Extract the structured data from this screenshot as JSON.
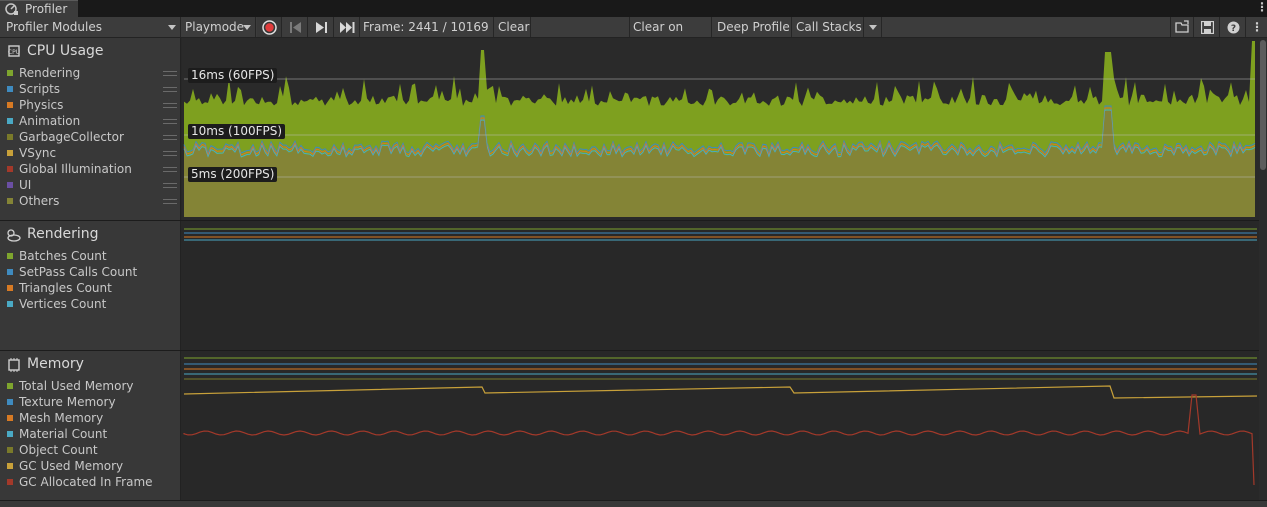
{
  "window": {
    "tab_title": "Profiler",
    "menu_glyph": "⋮"
  },
  "toolbar": {
    "modules_label": "Profiler Modules",
    "target_label": "Playmode",
    "record_icon": "record-icon",
    "frame_label": "Frame: 2441 / 10169",
    "clear_label": "Clear",
    "clear_on_play_label": "Clear on Play",
    "deep_profile_label": "Deep Profile",
    "call_stacks_label": "Call Stacks",
    "more_glyph": "⋮"
  },
  "cpu": {
    "title": "CPU Usage",
    "items": [
      {
        "label": "Rendering",
        "color": "#7ea52e"
      },
      {
        "label": "Scripts",
        "color": "#3f8bbf"
      },
      {
        "label": "Physics",
        "color": "#d77a24"
      },
      {
        "label": "Animation",
        "color": "#4aa9c4"
      },
      {
        "label": "GarbageCollector",
        "color": "#7a7a2a"
      },
      {
        "label": "VSync",
        "color": "#c8a13a"
      },
      {
        "label": "Global Illumination",
        "color": "#a3392a"
      },
      {
        "label": "UI",
        "color": "#6b4fa3"
      },
      {
        "label": "Others",
        "color": "#848436"
      }
    ],
    "markers": [
      "16ms (60FPS)",
      "10ms (100FPS)",
      "5ms (200FPS)"
    ]
  },
  "rendering": {
    "title": "Rendering",
    "items": [
      {
        "label": "Batches Count",
        "color": "#7ea52e"
      },
      {
        "label": "SetPass Calls Count",
        "color": "#3f8bbf"
      },
      {
        "label": "Triangles Count",
        "color": "#d77a24"
      },
      {
        "label": "Vertices Count",
        "color": "#4aa9c4"
      }
    ]
  },
  "memory": {
    "title": "Memory",
    "items": [
      {
        "label": "Total Used Memory",
        "color": "#7ea52e"
      },
      {
        "label": "Texture Memory",
        "color": "#3f8bbf"
      },
      {
        "label": "Mesh Memory",
        "color": "#d77a24"
      },
      {
        "label": "Material Count",
        "color": "#4aa9c4"
      },
      {
        "label": "Object Count",
        "color": "#7a7a2a"
      },
      {
        "label": "GC Used Memory",
        "color": "#c8a13a"
      },
      {
        "label": "GC Allocated In Frame",
        "color": "#a3392a"
      }
    ]
  }
}
